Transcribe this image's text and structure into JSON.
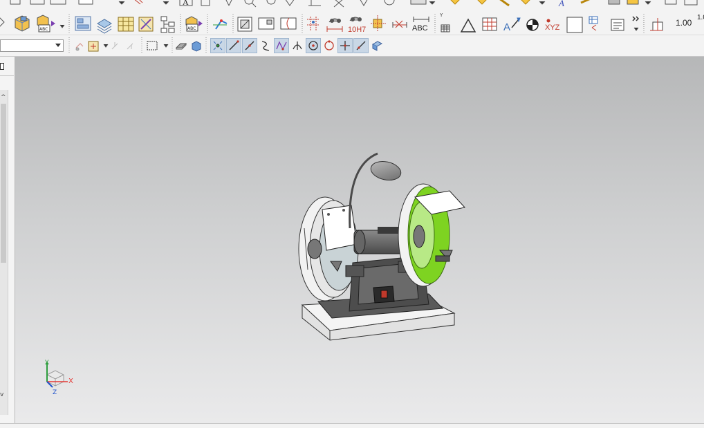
{
  "toolbar": {
    "scale_label": "1.00",
    "scale_label_2": "1.0",
    "abc_label": "ABC",
    "abc_label_2": "ABC",
    "fit_label": "10H7",
    "xyz_label": "XYZ",
    "layer_combo_value": ""
  },
  "colors": {
    "viewport_top": "#b6b7b8",
    "viewport_bottom": "#eaeaeb",
    "highlight_green": "#7ed321",
    "axis_x": "#e53935",
    "axis_y": "#2e9e3e",
    "axis_z": "#2255cc"
  },
  "triad": {
    "x_label": "X",
    "y_label": "Y",
    "z_label": "Z"
  },
  "icons": {
    "row0": [
      "dimension-icon",
      "sketch-icon",
      "text-icon",
      "point-icon",
      "zoom-icon",
      "flag-icon",
      "bookmark-icon"
    ],
    "row1": [
      "view-icon",
      "layers-icon",
      "table-icon",
      "measure-icon",
      "tree-icon",
      "label-icon",
      "axis-icon",
      "section-icon",
      "note-icon",
      "grid-icon",
      "triangle-icon",
      "symbol-icon",
      "wcs-icon"
    ],
    "row2": [
      "select-icon",
      "filter-icon",
      "snap-icon",
      "box-select-icon",
      "shade-icon",
      "snap-point-icon",
      "snap-line-icon",
      "snap-curve-icon",
      "snap-arc-icon",
      "snap-center-icon",
      "snap-circle-icon",
      "snap-cross-icon",
      "snap-tangent-icon",
      "view-cube-icon"
    ]
  }
}
